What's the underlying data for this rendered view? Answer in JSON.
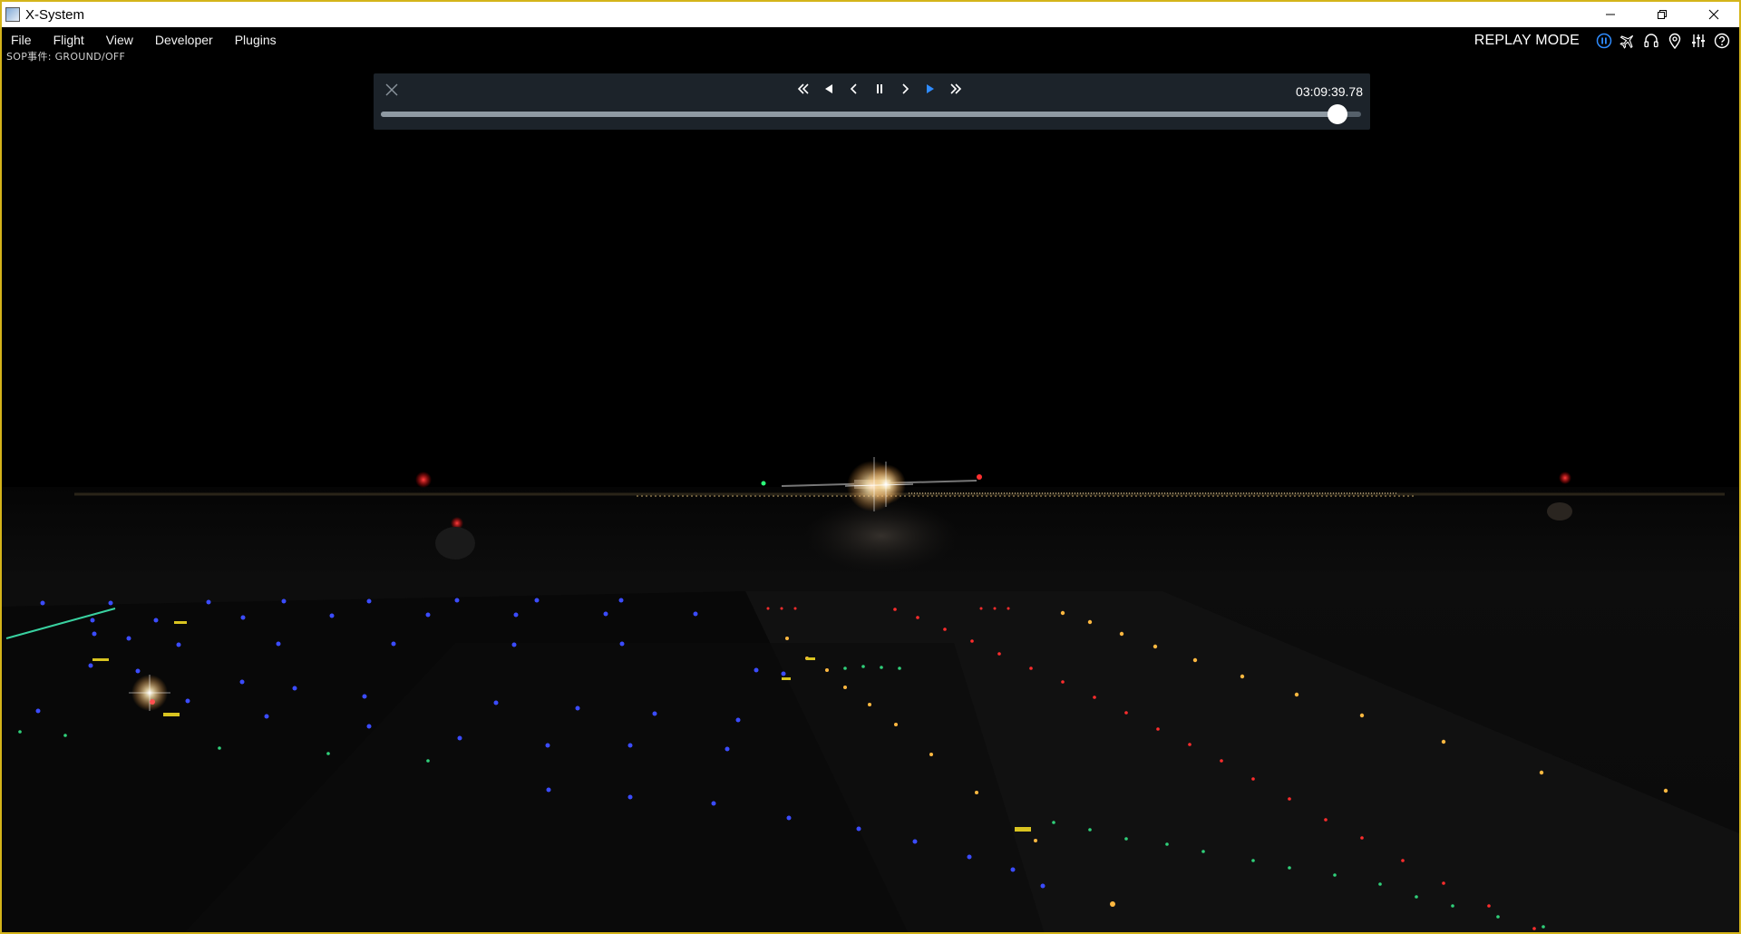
{
  "window": {
    "title": "X-System",
    "border_color": "#d4b41a"
  },
  "menubar": {
    "items": [
      "File",
      "Flight",
      "View",
      "Developer",
      "Plugins"
    ],
    "mode_label": "REPLAY MODE",
    "right_icons": [
      "pause-status-icon",
      "airplane-icon",
      "headset-icon",
      "map-pin-icon",
      "sliders-icon",
      "help-icon"
    ],
    "accent_color": "#2f8cff"
  },
  "status_text": "SOP事件:  GROUND/OFF",
  "replay": {
    "time": "03:09:39.78",
    "progress": 0.976,
    "controls": [
      "rewind-fast-icon",
      "play-reverse-icon",
      "step-back-icon",
      "pause-icon",
      "step-forward-icon",
      "play-icon",
      "fast-forward-icon"
    ],
    "active_color": "#2f8cff"
  },
  "scene": {
    "description_free": true,
    "sky_color": "#000000",
    "ground_color": "#0c0c0c"
  }
}
